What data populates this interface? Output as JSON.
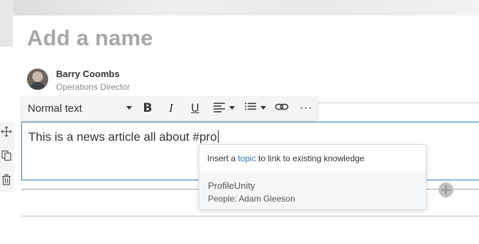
{
  "page": {
    "title_placeholder": "Add a name"
  },
  "author": {
    "name": "Barry Coombs",
    "role": "Operations Director"
  },
  "toolbar": {
    "text_style": "Normal text",
    "bold_label": "B",
    "italic_label": "I",
    "underline_label": "U",
    "more_label": "···",
    "icons": [
      "chevron-down-icon",
      "bold-icon",
      "italic-icon",
      "underline-icon",
      "align-icon",
      "list-icon",
      "link-icon",
      "more-icon"
    ]
  },
  "side_tools": {
    "icons": [
      "move-icon",
      "copy-icon",
      "delete-icon"
    ]
  },
  "editor": {
    "text": "This is a news article all about #pro"
  },
  "suggestion_popup": {
    "hint_prefix": "Insert a ",
    "hint_link": "topic",
    "hint_suffix": " to link to existing knowledge",
    "item_title": "ProfileUnity",
    "item_subtitle": "People: Adam Gleeson"
  },
  "colors": {
    "accent_blue": "#2f77b9",
    "link_blue": "#2a7ab8"
  }
}
